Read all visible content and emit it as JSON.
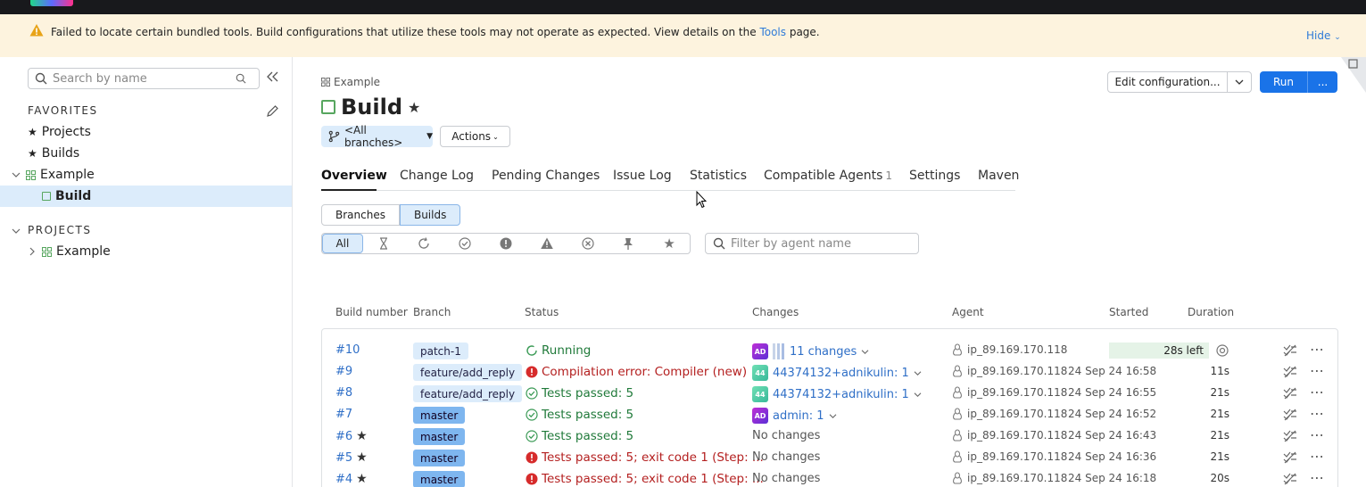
{
  "warning": {
    "text": "Failed to locate certain bundled tools. Build configurations that utilize these tools may not operate as expected. View details on the",
    "link": "Tools",
    "suffix": "page.",
    "hide": "Hide"
  },
  "sidebar": {
    "search_placeholder": "Search by name",
    "favorites_title": "FAVORITES",
    "projects_title": "PROJECTS",
    "favorites": [
      "Projects",
      "Builds"
    ],
    "tree": {
      "project": "Example",
      "config": "Build"
    },
    "projects": [
      "Example"
    ]
  },
  "header": {
    "breadcrumb": "Example",
    "title": "Build",
    "branch_selector": "<All branches>",
    "actions": "Actions",
    "edit_config": "Edit configuration...",
    "run": "Run",
    "run_more": "..."
  },
  "tabs": [
    {
      "label": "Overview"
    },
    {
      "label": "Change Log"
    },
    {
      "label": "Pending Changes"
    },
    {
      "label": "Issue Log"
    },
    {
      "label": "Statistics"
    },
    {
      "label": "Compatible Agents",
      "count": "1"
    },
    {
      "label": "Settings"
    },
    {
      "label": "Maven"
    }
  ],
  "view_toggle": [
    "Branches",
    "Builds"
  ],
  "filter_all": "All",
  "agent_filter_placeholder": "Filter by agent name",
  "columns": [
    "Build number",
    "Branch",
    "Status",
    "Changes",
    "Agent",
    "Started",
    "Duration"
  ],
  "builds": [
    {
      "number": "#10",
      "starred": false,
      "branch": "patch-1",
      "branch_style": "pale",
      "status": "Running",
      "status_kind": "running",
      "changes": "11 changes",
      "avatar": "AD",
      "agent": "ip_89.169.170.118",
      "started": "",
      "progress": "28s left",
      "duration": ""
    },
    {
      "number": "#9",
      "starred": false,
      "branch": "feature/add_reply",
      "branch_style": "pale",
      "status": "Compilation error: Compiler (new)",
      "status_kind": "err",
      "changes": "44374132+adnikulin: 1",
      "avatar": "44",
      "agent": "ip_89.169.170.118",
      "started": "24 Sep 24 16:58",
      "duration": "11s"
    },
    {
      "number": "#8",
      "starred": false,
      "branch": "feature/add_reply",
      "branch_style": "pale",
      "status": "Tests passed: 5",
      "status_kind": "ok",
      "changes": "44374132+adnikulin: 1",
      "avatar": "44",
      "agent": "ip_89.169.170.118",
      "started": "24 Sep 24 16:55",
      "duration": "21s"
    },
    {
      "number": "#7",
      "starred": false,
      "branch": "master",
      "branch_style": "blue",
      "status": "Tests passed: 5",
      "status_kind": "ok",
      "changes": "admin: 1",
      "avatar": "AD",
      "agent": "ip_89.169.170.118",
      "started": "24 Sep 24 16:52",
      "duration": "21s"
    },
    {
      "number": "#6",
      "starred": true,
      "branch": "master",
      "branch_style": "blue",
      "status": "Tests passed: 5",
      "status_kind": "ok",
      "changes": "No changes",
      "avatar": "",
      "agent": "ip_89.169.170.118",
      "started": "24 Sep 24 16:43",
      "duration": "21s"
    },
    {
      "number": "#5",
      "starred": true,
      "branch": "master",
      "branch_style": "blue",
      "status": "Tests passed: 5; exit code 1 (Step: ...",
      "status_kind": "err",
      "changes": "No changes",
      "avatar": "",
      "agent": "ip_89.169.170.118",
      "started": "24 Sep 24 16:36",
      "duration": "21s"
    },
    {
      "number": "#4",
      "starred": true,
      "branch": "master",
      "branch_style": "blue",
      "status": "Tests passed: 5; exit code 1 (Step: ...",
      "status_kind": "err",
      "changes": "No changes",
      "avatar": "",
      "agent": "ip_89.169.170.118",
      "started": "24 Sep 24 16:18",
      "duration": "20s"
    }
  ]
}
